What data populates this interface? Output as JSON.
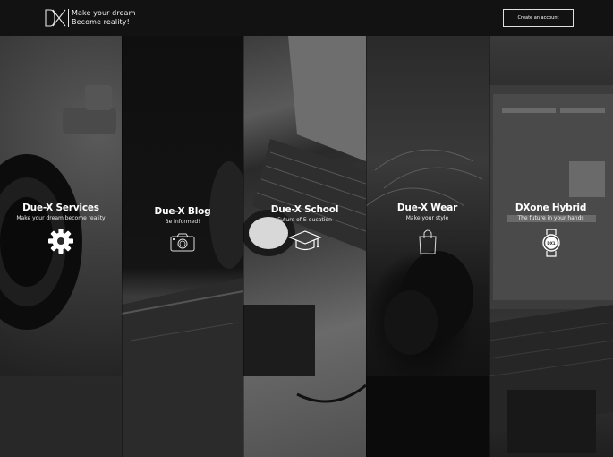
{
  "header": {
    "logo_mark": "DX",
    "tagline_line1": "Make your dream",
    "tagline_line2": "Become reality!",
    "cta_label": "Create an account"
  },
  "panels": [
    {
      "title": "Due-X Services",
      "subtitle": "Make your dream become reality",
      "icon": "gear-icon"
    },
    {
      "title": "Due-X  Blog",
      "subtitle": "Be informed!",
      "icon": "camera-icon"
    },
    {
      "title": "Due-X School",
      "subtitle": "Future of  E-ducation",
      "icon": "graduation-cap-icon"
    },
    {
      "title": "Due-X Wear",
      "subtitle": "Make your style",
      "icon": "shopping-bag-icon"
    },
    {
      "title": "DXone  Hybrid",
      "subtitle": "The future in your hands",
      "icon": "smartwatch-icon",
      "icon_text": "DX1"
    }
  ],
  "colors": {
    "header_bg": "#121212",
    "text": "#ffffff"
  }
}
